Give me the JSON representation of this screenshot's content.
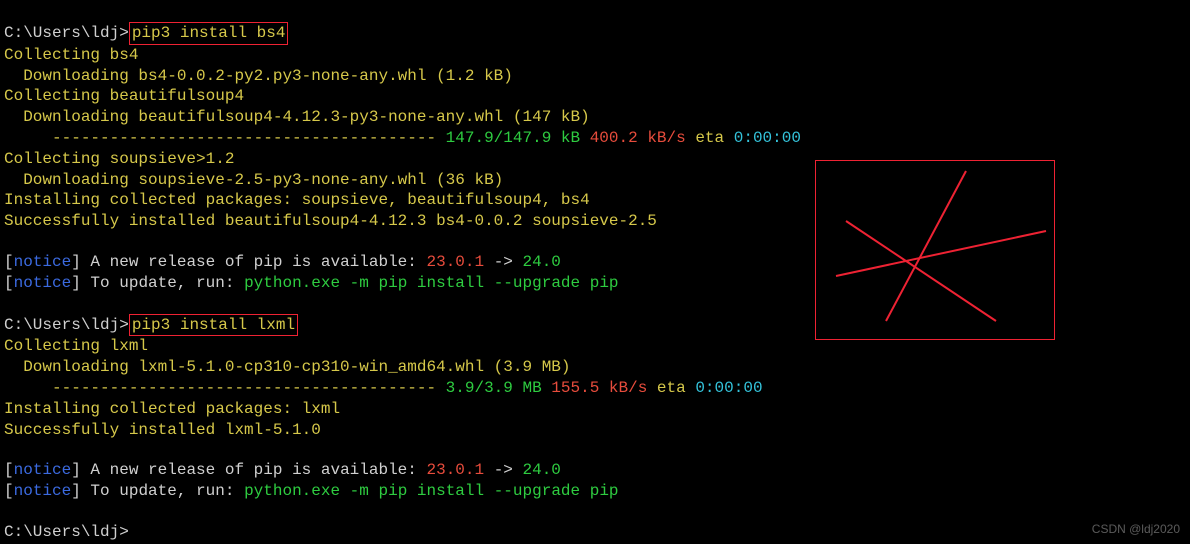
{
  "prompt1_path": "C:\\Users\\ldj>",
  "cmd1": "pip3 install bs4",
  "bs4": {
    "collecting": "Collecting bs4",
    "download": "  Downloading bs4-0.0.2-py2.py3-none-any.whl (1.2 kB)",
    "collecting_bsoup": "Collecting beautifulsoup4",
    "download_bsoup": "  Downloading beautifulsoup4-4.12.3-py3-none-any.whl (147 kB)",
    "bar": "     ---------------------------------------- ",
    "progress_size": "147.9/147.9 kB ",
    "progress_speed": "400.2 kB/s",
    "progress_eta_label": " eta ",
    "progress_eta": "0:00:00",
    "collecting_sieve": "Collecting soupsieve>1.2",
    "download_sieve": "  Downloading soupsieve-2.5-py3-none-any.whl (36 kB)",
    "installing": "Installing collected packages: soupsieve, beautifulsoup4, bs4",
    "success": "Successfully installed beautifulsoup4-4.12.3 bs4-0.0.2 soupsieve-2.5"
  },
  "notice1": {
    "lb": "[",
    "tag": "notice",
    "rb": "]",
    "msg_a": " A new release of pip is available: ",
    "old": "23.0.1",
    "arrow": " -> ",
    "new": "24.0",
    "msg_b": " To update, run: ",
    "cmd": "python.exe -m pip install --upgrade pip"
  },
  "prompt2_path": "C:\\Users\\ldj>",
  "cmd2": "pip3 install lxml",
  "lxml": {
    "collecting": "Collecting lxml",
    "download": "  Downloading lxml-5.1.0-cp310-cp310-win_amd64.whl (3.9 MB)",
    "bar": "     ---------------------------------------- ",
    "progress_size": "3.9/3.9 MB ",
    "progress_speed": "155.5 kB/s",
    "progress_eta_label": " eta ",
    "progress_eta": "0:00:00",
    "installing": "Installing collected packages: lxml",
    "success": "Successfully installed lxml-5.1.0"
  },
  "prompt3_path": "C:\\Users\\ldj>",
  "watermark": "CSDN @ldj2020"
}
